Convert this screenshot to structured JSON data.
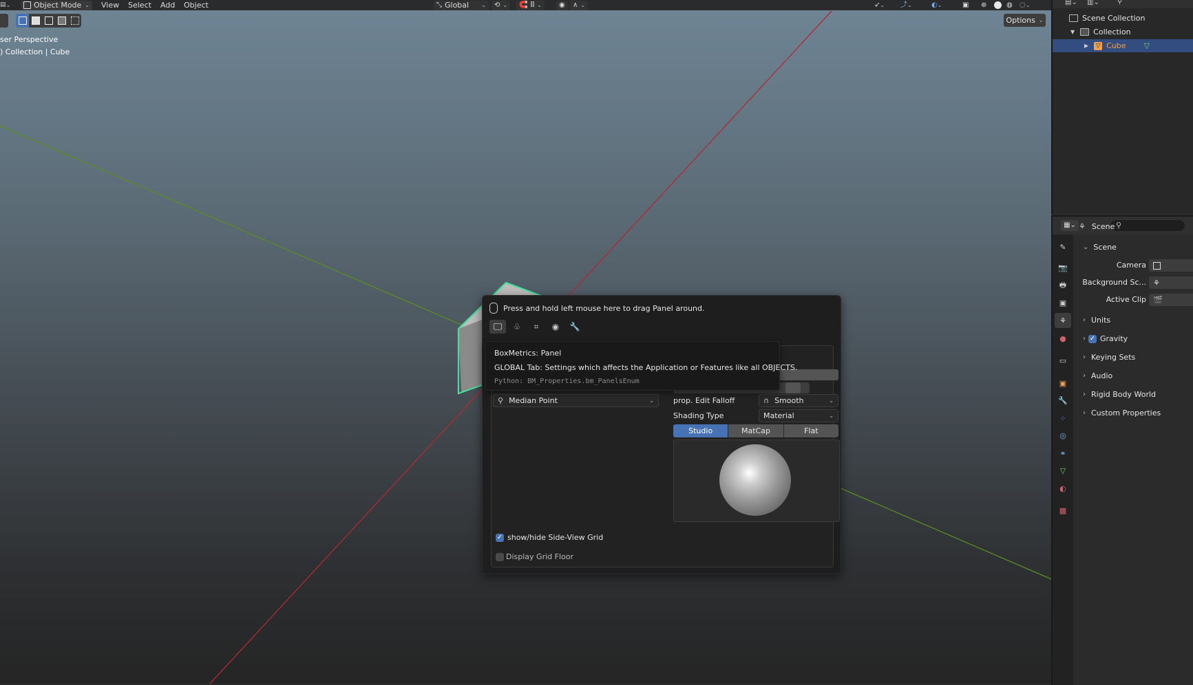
{
  "header": {
    "mode_label": "Object Mode",
    "menu": [
      "View",
      "Select",
      "Add",
      "Object"
    ],
    "orientation_label": "Global"
  },
  "viewport": {
    "view_name": "User Perspective",
    "view_name_visible": "ser Perspective",
    "context_visible": ") Collection | Cube",
    "options_label": "Options"
  },
  "panel": {
    "drag_hint": "Press and hold left mouse here to drag Panel around.",
    "tabs": [
      "global-tab-icon",
      "sculpt-tab-icon",
      "snap-tab-icon",
      "visibility-tab-icon",
      "modifier-tab-icon"
    ],
    "pivot_value": "Median Point",
    "falloff_label": "prop. Edit Falloff",
    "falloff_value": "Smooth",
    "shading_label": "Shading Type",
    "shading_value": "Material",
    "lighting_options": [
      "Studio",
      "MatCap",
      "Flat"
    ],
    "lighting_selected": "Studio",
    "side_grid_label": "show/hide Side-View Grid",
    "side_grid_checked": true,
    "grid_floor_label": "Display Grid Floor",
    "grid_floor_checked": false
  },
  "tooltip": {
    "title": "BoxMetrics: Panel",
    "description": "GLOBAL Tab: Settings which affects the Application or Features like all OBJECTS.",
    "python": "Python: BM_Properties.bm_PanelsEnum"
  },
  "outliner": {
    "root": "Scene Collection",
    "collection": "Collection",
    "object": "Cube"
  },
  "properties": {
    "context_title": "Scene",
    "section_title": "Scene",
    "fields": [
      {
        "label": "Camera"
      },
      {
        "label": "Background Sc..."
      },
      {
        "label": "Active Clip"
      }
    ],
    "subpanels": [
      {
        "label": "Units",
        "checkbox": false
      },
      {
        "label": "Gravity",
        "checkbox": true
      },
      {
        "label": "Keying Sets",
        "checkbox": false
      },
      {
        "label": "Audio",
        "checkbox": false
      },
      {
        "label": "Rigid Body World",
        "checkbox": false
      },
      {
        "label": "Custom Properties",
        "checkbox": false
      }
    ]
  },
  "colors": {
    "accent": "#4772b3",
    "selection_outline": "#46e09a",
    "x_axis": "#b02a33",
    "y_axis": "#5a8c23",
    "object_name": "#f0a050"
  }
}
